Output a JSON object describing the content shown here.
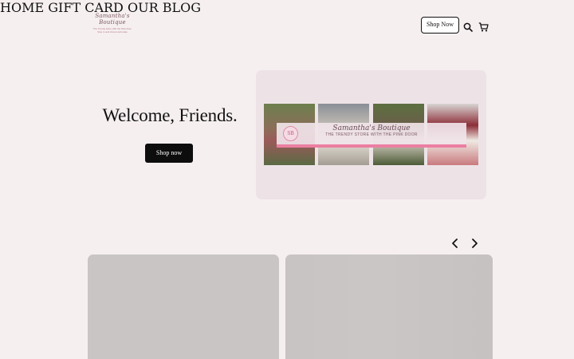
{
  "header": {
    "logo": {
      "script_text": "Samantha's Boutique",
      "tagline_1": "The Trendy Store with the Pink Door",
      "tagline_2": "Stop in and shop local today"
    },
    "nav": [
      {
        "label": "HOME"
      },
      {
        "label": "GIFT CARD"
      },
      {
        "label": "OUR BLOG"
      }
    ],
    "shop_button": "Shop Now",
    "icons": [
      "search-icon",
      "cart-icon"
    ]
  },
  "hero": {
    "title": "Welcome, Friends.",
    "button": "Shop now",
    "banner": {
      "monogram": "SB",
      "title": "Samantha's Boutique",
      "subtitle": "THE TRENDY STORE WITH THE PINK DOOR"
    }
  },
  "carousel": {
    "prev_icon": "chevron-left-icon",
    "next_icon": "chevron-right-icon"
  },
  "colors": {
    "background": "#f6eff0",
    "hero_card": "#ede3e7",
    "accent_pink": "#ec7fa2",
    "button_dark": "#0d0d0d",
    "card_placeholder": "#c9c5c5"
  }
}
